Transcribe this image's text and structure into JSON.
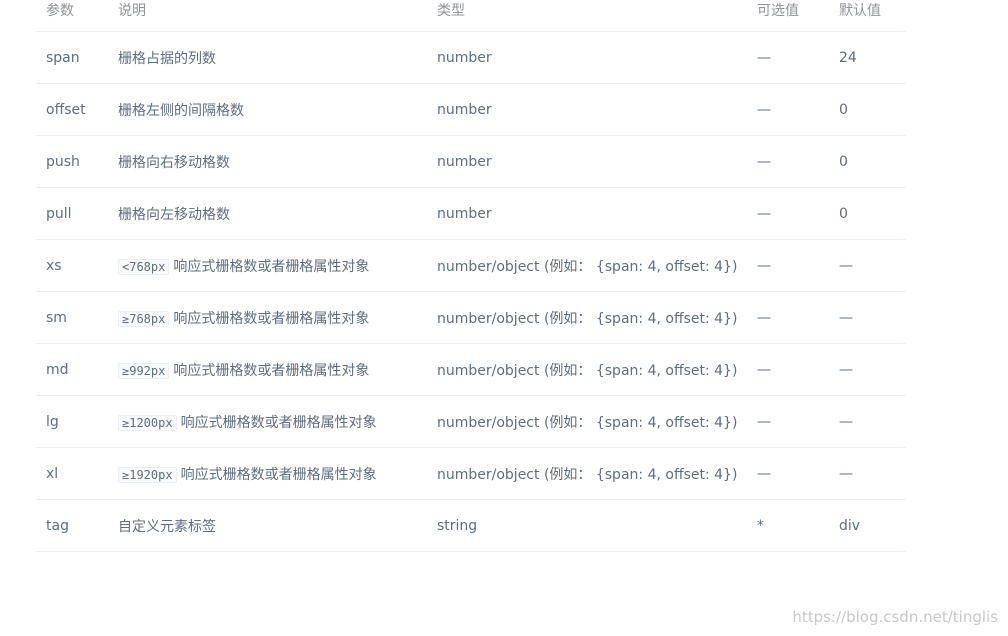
{
  "table": {
    "headers": {
      "param": "参数",
      "desc": "说明",
      "type": "类型",
      "options": "可选值",
      "default": "默认值"
    },
    "rows": [
      {
        "param": "span",
        "code": "",
        "desc": "栅格占据的列数",
        "type": "number",
        "options": "—",
        "default": "24"
      },
      {
        "param": "offset",
        "code": "",
        "desc": "栅格左侧的间隔格数",
        "type": "number",
        "options": "—",
        "default": "0"
      },
      {
        "param": "push",
        "code": "",
        "desc": "栅格向右移动格数",
        "type": "number",
        "options": "—",
        "default": "0"
      },
      {
        "param": "pull",
        "code": "",
        "desc": "栅格向左移动格数",
        "type": "number",
        "options": "—",
        "default": "0"
      },
      {
        "param": "xs",
        "code": "<768px",
        "desc": "响应式栅格数或者栅格属性对象",
        "type": "number/object (例如： {span: 4, offset: 4})",
        "options": "—",
        "default": "—"
      },
      {
        "param": "sm",
        "code": "≥768px",
        "desc": "响应式栅格数或者栅格属性对象",
        "type": "number/object (例如： {span: 4, offset: 4})",
        "options": "—",
        "default": "—"
      },
      {
        "param": "md",
        "code": "≥992px",
        "desc": "响应式栅格数或者栅格属性对象",
        "type": "number/object (例如： {span: 4, offset: 4})",
        "options": "—",
        "default": "—"
      },
      {
        "param": "lg",
        "code": "≥1200px",
        "desc": "响应式栅格数或者栅格属性对象",
        "type": "number/object (例如： {span: 4, offset: 4})",
        "options": "—",
        "default": "—"
      },
      {
        "param": "xl",
        "code": "≥1920px",
        "desc": "响应式栅格数或者栅格属性对象",
        "type": "number/object (例如： {span: 4, offset: 4})",
        "options": "—",
        "default": "—"
      },
      {
        "param": "tag",
        "code": "",
        "desc": "自定义元素标签",
        "type": "string",
        "options": "*",
        "default": "div"
      }
    ]
  },
  "watermark": "https://blog.csdn.net/tinglis"
}
